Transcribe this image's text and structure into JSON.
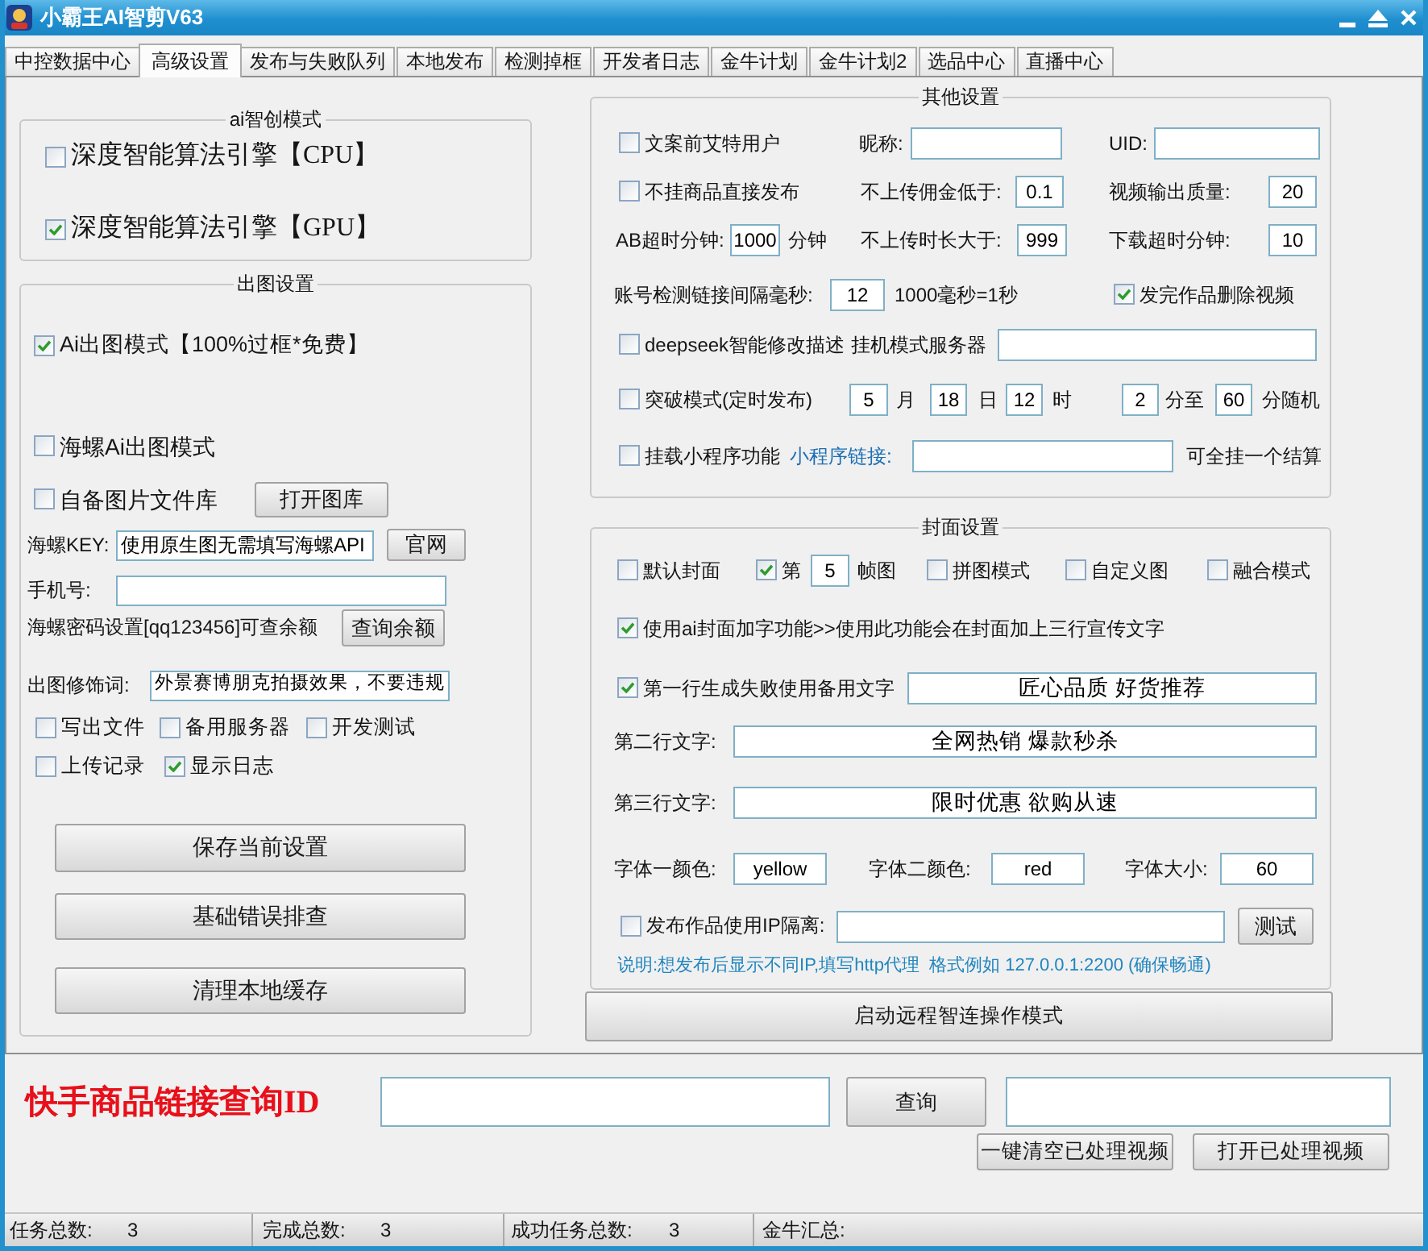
{
  "window": {
    "title": "小霸王AI智剪V63"
  },
  "tabs": [
    {
      "label": "中控数据中心",
      "selected": false
    },
    {
      "label": "高级设置",
      "selected": true
    },
    {
      "label": "发布与失败队列",
      "selected": false
    },
    {
      "label": "本地发布",
      "selected": false
    },
    {
      "label": "检测掉框",
      "selected": false
    },
    {
      "label": "开发者日志",
      "selected": false
    },
    {
      "label": "金牛计划",
      "selected": false
    },
    {
      "label": "金牛计划2",
      "selected": false
    },
    {
      "label": "选品中心",
      "selected": false
    },
    {
      "label": "直播中心",
      "selected": false
    }
  ],
  "ai_mode": {
    "title": "ai智创模式",
    "rows": [
      {
        "items": [
          {
            "kind": "checkbox",
            "label": "深度智能算法引擎【CPU】",
            "checked": false
          }
        ]
      },
      {
        "items": [
          {
            "kind": "checkbox",
            "label": "深度智能算法引擎【GPU】",
            "checked": true
          }
        ]
      }
    ]
  },
  "image_settings": {
    "title": "出图设置",
    "rows": [
      {
        "items": [
          {
            "kind": "checkbox",
            "label": "Ai出图模式【100%过框*免费】",
            "checked": true
          }
        ]
      },
      {
        "items": [
          {
            "kind": "checkbox",
            "label": "海螺Ai出图模式",
            "checked": false
          }
        ]
      },
      {
        "items": [
          {
            "kind": "checkbox",
            "label": "自备图片文件库",
            "checked": false
          },
          {
            "kind": "button",
            "label": "打开图库"
          }
        ]
      },
      {
        "items": [
          {
            "kind": "text",
            "text": "海螺KEY:"
          },
          {
            "kind": "input",
            "value": "使用原生图无需填写海螺API"
          },
          {
            "kind": "button",
            "label": "官网"
          }
        ]
      },
      {
        "items": [
          {
            "kind": "text",
            "text": "手机号:"
          },
          {
            "kind": "input"
          }
        ]
      },
      {
        "items": [
          {
            "kind": "text",
            "text": "海螺密码设置[qq123456]可查余额"
          },
          {
            "kind": "button",
            "label": "查询余额"
          }
        ]
      },
      {
        "items": [
          {
            "kind": "text",
            "text": "出图修饰词:"
          },
          {
            "kind": "input",
            "value": "外景赛博朋克拍摄效果，不要违规"
          }
        ]
      },
      {
        "items": [
          {
            "kind": "checkbox",
            "label": "写出文件",
            "checked": false
          },
          {
            "kind": "checkbox",
            "label": "备用服务器",
            "checked": false
          },
          {
            "kind": "checkbox",
            "label": "开发测试",
            "checked": false
          }
        ]
      },
      {
        "items": [
          {
            "kind": "checkbox",
            "label": "上传记录",
            "checked": false
          },
          {
            "kind": "checkbox",
            "label": "显示日志",
            "checked": true
          }
        ]
      },
      {
        "items": [
          {
            "kind": "button",
            "label": "保存当前设置"
          }
        ]
      },
      {
        "items": [
          {
            "kind": "button",
            "label": "基础错误排查"
          }
        ]
      },
      {
        "items": [
          {
            "kind": "button",
            "label": "清理本地缓存"
          }
        ]
      }
    ]
  },
  "other_settings": {
    "title": "其他设置",
    "rows": [
      {
        "items": [
          {
            "kind": "checkbox",
            "label": "文案前艾特用户",
            "checked": false
          },
          {
            "kind": "text",
            "text": "昵称:"
          },
          {
            "kind": "input"
          },
          {
            "kind": "text",
            "text": "UID:"
          },
          {
            "kind": "input"
          }
        ]
      },
      {
        "items": [
          {
            "kind": "checkbox",
            "label": "不挂商品直接发布",
            "checked": false
          },
          {
            "kind": "text",
            "text": "不上传佣金低于:"
          },
          {
            "kind": "input",
            "value": "0.1"
          },
          {
            "kind": "text",
            "text": "视频输出质量:"
          },
          {
            "kind": "input",
            "value": "20"
          }
        ]
      },
      {
        "items": [
          {
            "kind": "text",
            "text": "AB超时分钟:"
          },
          {
            "kind": "input",
            "value": "1000"
          },
          {
            "kind": "text",
            "text": "分钟"
          },
          {
            "kind": "text",
            "text": "不上传时长大于:"
          },
          {
            "kind": "input",
            "value": "999"
          },
          {
            "kind": "text",
            "text": "下载超时分钟:"
          },
          {
            "kind": "input",
            "value": "10"
          }
        ]
      },
      {
        "items": [
          {
            "kind": "text",
            "text": "账号检测链接间隔毫秒:"
          },
          {
            "kind": "input",
            "value": "12"
          },
          {
            "kind": "text",
            "text": "1000毫秒=1秒"
          },
          {
            "kind": "checkbox",
            "label": "发完作品删除视频",
            "checked": true
          }
        ]
      },
      {
        "items": [
          {
            "kind": "checkbox",
            "label": "deepseek智能修改描述",
            "checked": false
          },
          {
            "kind": "text",
            "text": "挂机模式服务器"
          },
          {
            "kind": "input"
          }
        ]
      },
      {
        "items": [
          {
            "kind": "checkbox",
            "label": "突破模式(定时发布)",
            "checked": false
          },
          {
            "kind": "input",
            "value": "5"
          },
          {
            "kind": "text",
            "text": "月"
          },
          {
            "kind": "input",
            "value": "18"
          },
          {
            "kind": "text",
            "text": "日"
          },
          {
            "kind": "input",
            "value": "12"
          },
          {
            "kind": "text",
            "text": "时"
          },
          {
            "kind": "input",
            "value": "2"
          },
          {
            "kind": "text",
            "text": "分至"
          },
          {
            "kind": "input",
            "value": "60"
          },
          {
            "kind": "text",
            "text": "分随机"
          }
        ]
      },
      {
        "items": [
          {
            "kind": "checkbox",
            "label": "挂载小程序功能",
            "checked": false
          },
          {
            "kind": "hint",
            "text": "小程序链接:"
          },
          {
            "kind": "input"
          },
          {
            "kind": "text",
            "text": "可全挂一个结算"
          }
        ]
      }
    ]
  },
  "cover_settings": {
    "title": "封面设置",
    "rows": [
      {
        "items": [
          {
            "kind": "checkbox",
            "label": "默认封面",
            "checked": false
          },
          {
            "kind": "checkbox",
            "label": "第",
            "checked": true
          },
          {
            "kind": "input",
            "value": "5"
          },
          {
            "kind": "text",
            "text": "帧图"
          },
          {
            "kind": "checkbox",
            "label": "拼图模式",
            "checked": false
          },
          {
            "kind": "checkbox",
            "label": "自定义图",
            "checked": false
          },
          {
            "kind": "checkbox",
            "label": "融合模式",
            "checked": false
          }
        ]
      },
      {
        "items": [
          {
            "kind": "checkbox",
            "label": "使用ai封面加字功能>>使用此功能会在封面加上三行宣传文字",
            "checked": true
          }
        ]
      },
      {
        "items": [
          {
            "kind": "checkbox",
            "label": "第一行生成失败使用备用文字",
            "checked": true
          },
          {
            "kind": "input",
            "value": "匠心品质 好货推荐"
          }
        ]
      },
      {
        "items": [
          {
            "kind": "text",
            "text": "第二行文字:"
          },
          {
            "kind": "input",
            "value": "全网热销 爆款秒杀"
          }
        ]
      },
      {
        "items": [
          {
            "kind": "text",
            "text": "第三行文字:"
          },
          {
            "kind": "input",
            "value": "限时优惠 欲购从速"
          }
        ]
      },
      {
        "items": [
          {
            "kind": "text",
            "text": "字体一颜色:"
          },
          {
            "kind": "input",
            "value": "yellow"
          },
          {
            "kind": "text",
            "text": "字体二颜色:"
          },
          {
            "kind": "input",
            "value": "red"
          },
          {
            "kind": "text",
            "text": "字体大小:"
          },
          {
            "kind": "input",
            "value": "60"
          }
        ]
      },
      {
        "items": [
          {
            "kind": "checkbox",
            "label": "发布作品使用IP隔离:",
            "checked": false
          },
          {
            "kind": "input"
          },
          {
            "kind": "button",
            "label": "测试"
          }
        ]
      },
      {
        "items": [
          {
            "kind": "hint",
            "text": "说明:想发布后显示不同IP,填写http代理  格式例如 127.0.0.1:2200 (确保畅通)"
          }
        ]
      }
    ]
  },
  "remote_button": "启动远程智连操作模式",
  "query_bar": {
    "title": "快手商品链接查询ID",
    "button": "查询"
  },
  "actions": [
    "一键清空已处理视频",
    "打开已处理视频"
  ],
  "status_bar": [
    {
      "label": "任务总数:",
      "value": "3"
    },
    {
      "label": "完成总数:",
      "value": "3"
    },
    {
      "label": "成功任务总数:",
      "value": "3"
    },
    {
      "label": "金牛汇总:"
    }
  ]
}
